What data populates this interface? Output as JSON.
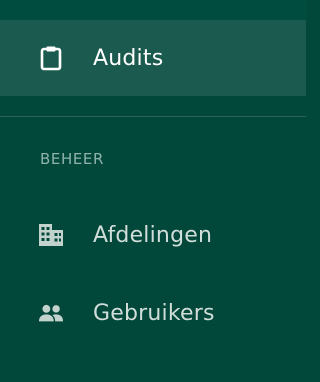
{
  "sidebar": {
    "items": [
      {
        "label": "Audits",
        "icon": "clipboard-icon",
        "active": true
      }
    ],
    "section": {
      "header": "BEHEER",
      "items": [
        {
          "label": "Afdelingen",
          "icon": "building-icon"
        },
        {
          "label": "Gebruikers",
          "icon": "people-icon"
        }
      ]
    }
  },
  "colors": {
    "sidebar_bg": "#01473a",
    "active_bg": "#1b5a4e",
    "section_header": "#8fb3ab",
    "inactive_text": "#d1ddd9",
    "icon_inactive": "#c2d3ce"
  }
}
